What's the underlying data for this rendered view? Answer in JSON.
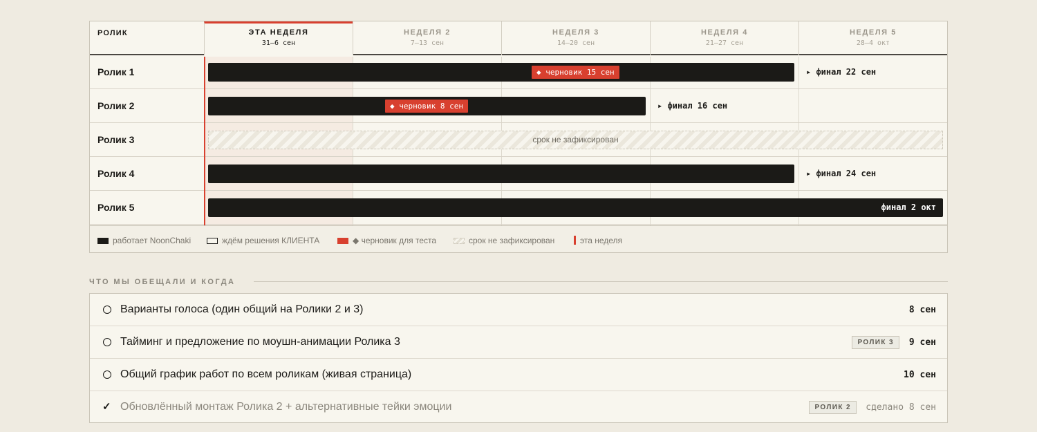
{
  "timeline": {
    "col_header": "РОЛИК",
    "weeks": [
      {
        "label": "ЭТА НЕДЕЛЯ",
        "dates": "31–6 сен",
        "current": true
      },
      {
        "label": "НЕДЕЛЯ 2",
        "dates": "7–13 сен"
      },
      {
        "label": "НЕДЕЛЯ 3",
        "dates": "14–20 сен"
      },
      {
        "label": "НЕДЕЛЯ 4",
        "dates": "21–27 сен"
      },
      {
        "label": "НЕДЕЛЯ 5",
        "dates": "28–4 окт"
      }
    ],
    "rows": [
      {
        "name": "Ролик 1",
        "draft": "◆ черновик 15 сен",
        "final": "▸ финал 22 сен"
      },
      {
        "name": "Ролик 2",
        "draft": "◆ черновик 8 сен",
        "final": "▸ финал 16 сен"
      },
      {
        "name": "Ролик 3",
        "unfixed": "срок не зафиксирован"
      },
      {
        "name": "Ролик 4",
        "final": "▸ финал 24 сен"
      },
      {
        "name": "Ролик 5",
        "final": "финал 2 окт"
      }
    ],
    "legend": [
      {
        "label": "работает NoonChaki",
        "color": "#1b1a17"
      },
      {
        "label": "ждём решения КЛИЕНТА"
      },
      {
        "label": "◆ черновик для теста",
        "color": "#d8402f"
      },
      {
        "label": "срок не зафиксирован"
      },
      {
        "label": "эта неделя",
        "color": "#d8402f"
      }
    ]
  },
  "promises": {
    "title": "ЧТО МЫ ОБЕЩАЛИ И КОГДА",
    "items": [
      {
        "text": "Варианты голоса (один общий на Ролики 2 и 3)",
        "date": "8 сен",
        "done": false
      },
      {
        "text": "Тайминг и предложение по моушн-анимации Ролика 3",
        "tag": "РОЛИК 3",
        "date": "9 сен",
        "done": false
      },
      {
        "text": "Общий график работ по всем роликам (живая страница)",
        "date": "10 сен",
        "done": false
      },
      {
        "text": "Обновлённый монтаж Ролика 2 + альтернативные тейки эмоции",
        "tag": "РОЛИК 2",
        "date": "сделано 8 сен",
        "done": true
      }
    ]
  }
}
